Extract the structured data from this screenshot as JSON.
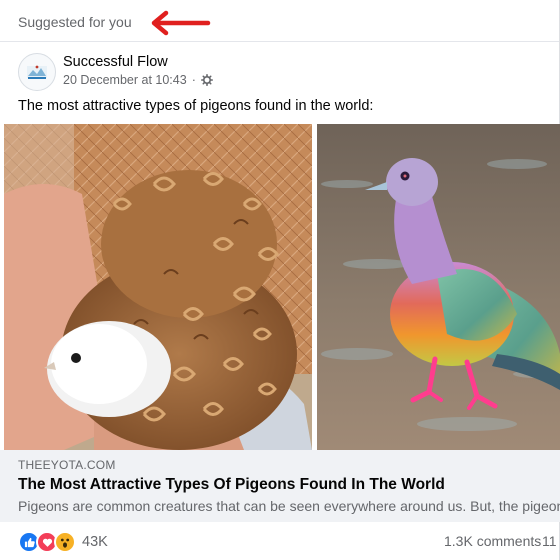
{
  "feed": {
    "suggested_label": "Suggested for you"
  },
  "post": {
    "page_name": "Successful Flow",
    "timestamp": "20 December at 10:43",
    "audience_icon": "gear-icon",
    "text": "The most attractive types of pigeons found in the world:"
  },
  "link_preview": {
    "domain": "THEEYOTA.COM",
    "title": "The Most Attractive Types Of Pigeons Found In The World",
    "description": "Pigeons are common creatures that can be seen everywhere around us. But, the pigeons"
  },
  "engagement": {
    "reaction_icons": [
      "like-icon",
      "love-icon",
      "wow-icon"
    ],
    "reaction_count": "43K",
    "comments": "1.3K comments",
    "shares_partial": "11"
  },
  "colors": {
    "like_blue": "#1877f2",
    "love_red": "#f33e58",
    "wow_yellow": "#f7b125",
    "annotation_red": "#e0201f"
  }
}
